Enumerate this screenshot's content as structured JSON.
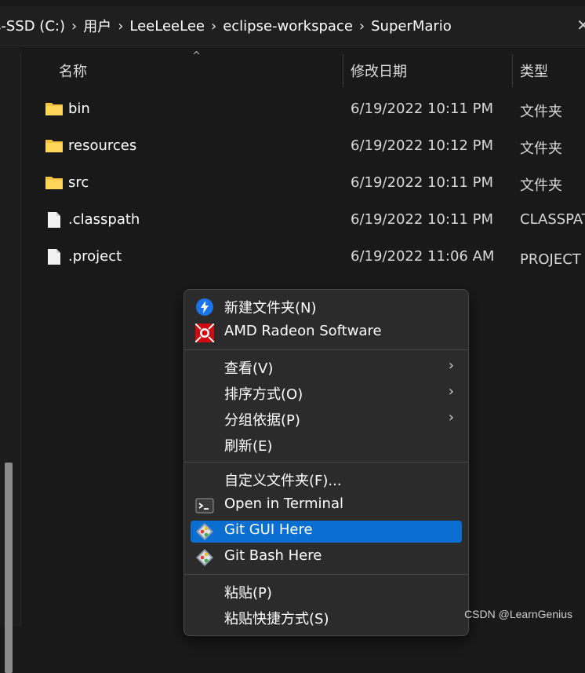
{
  "breadcrumb": {
    "parts": [
      "s-SSD (C:)",
      "用户",
      "LeeLeeLee",
      "eclipse-workspace",
      "SuperMario"
    ]
  },
  "columns": {
    "name": "名称",
    "date": "修改日期",
    "type": "类型"
  },
  "files": [
    {
      "name": "bin",
      "date": "6/19/2022 10:11 PM",
      "type": "文件夹",
      "icon": "folder-icon"
    },
    {
      "name": "resources",
      "date": "6/19/2022 10:12 PM",
      "type": "文件夹",
      "icon": "folder-icon"
    },
    {
      "name": "src",
      "date": "6/19/2022 10:11 PM",
      "type": "文件夹",
      "icon": "folder-icon"
    },
    {
      "name": ".classpath",
      "date": "6/19/2022 10:11 PM",
      "type": "CLASSPATH",
      "icon": "file-icon"
    },
    {
      "name": ".project",
      "date": "6/19/2022 11:06 AM",
      "type": "PROJECT 文件",
      "icon": "file-icon"
    }
  ],
  "context_menu": {
    "items": [
      {
        "label": "新建文件夹(N)",
        "icon": "new-folder-icon"
      },
      {
        "label": "AMD Radeon Software",
        "icon": "amd-radeon-icon"
      },
      {
        "label": "查看(V)",
        "submenu": true
      },
      {
        "label": "排序方式(O)",
        "submenu": true
      },
      {
        "label": "分组依据(P)",
        "submenu": true
      },
      {
        "label": "刷新(E)"
      },
      {
        "label": "自定义文件夹(F)..."
      },
      {
        "label": "Open in Terminal",
        "icon": "terminal-icon"
      },
      {
        "label": "Git GUI Here",
        "icon": "git-icon",
        "highlighted": true
      },
      {
        "label": "Git Bash Here",
        "icon": "git-icon"
      },
      {
        "label": "粘贴(P)"
      },
      {
        "label": "粘贴快捷方式(S)"
      }
    ],
    "submenu_glyph": "›"
  },
  "watermark": "CSDN @LearnGenius",
  "colors": {
    "background": "#191919",
    "menu": "#2b2b2b",
    "highlight": "#0b6fd1",
    "folder": "#f4c23f"
  }
}
